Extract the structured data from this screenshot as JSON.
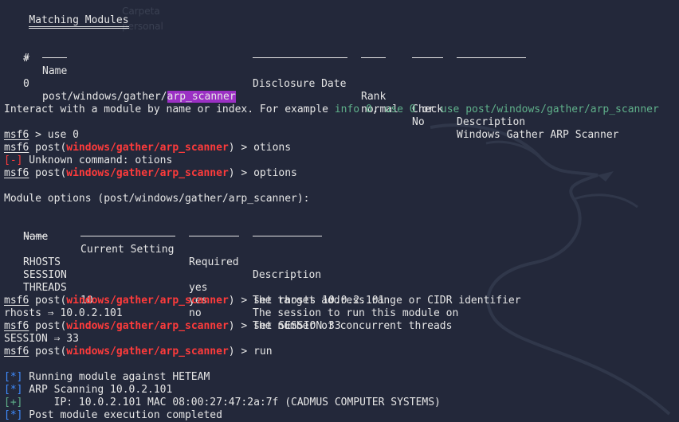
{
  "background": {
    "ghost_label_1": "Carpeta",
    "ghost_label_2": "personal",
    "color": "#23283a"
  },
  "matching": {
    "title": "Matching Modules",
    "headers": {
      "num": "#",
      "name": "Name",
      "date": "Disclosure Date",
      "rank": "Rank",
      "check": "Check",
      "desc": "Description"
    },
    "row": {
      "num": "0",
      "name_prefix": "post/windows/gather/",
      "name_hl": "arp_scanner",
      "date": "",
      "rank": "normal",
      "check": "No",
      "desc": "Windows Gather ARP Scanner"
    }
  },
  "interact": {
    "text1": "Interact with a module by name or index. For example ",
    "info": "info 0",
    "sep1": ", ",
    "use": "use 0",
    "sep2": " or ",
    "use_path": "use post/windows/gather/arp_scanner"
  },
  "prompt": {
    "name": "msf6",
    "post_open": "post(",
    "module": "windows/gather/arp_scanner",
    "post_close": ")",
    "arrow": " > "
  },
  "session": {
    "cmd1": "use 0",
    "cmd2": "otions",
    "err_tag": "[-]",
    "err_msg": " Unknown command: otions",
    "cmd3": "options",
    "module_options": "Module options (post/windows/gather/arp_scanner):"
  },
  "options": {
    "headers": {
      "name": "Name",
      "setting": "Current Setting",
      "required": "Required",
      "desc": "Description"
    },
    "rows": [
      {
        "name": "RHOSTS",
        "setting": "",
        "required": "yes",
        "desc": "The target address range or CIDR identifier"
      },
      {
        "name": "SESSION",
        "setting": "",
        "required": "yes",
        "desc": "The session to run this module on"
      },
      {
        "name": "THREADS",
        "setting": "10",
        "required": "no",
        "desc": "The number of concurrent threads"
      }
    ]
  },
  "run": {
    "cmd4": "set rhosts 10.0.2.101",
    "out4": "rhosts ⇒ 10.0.2.101",
    "cmd5": "set SESSION 33",
    "out5": "SESSION ⇒ 33",
    "cmd6": "run",
    "msgs": [
      {
        "tag": "[*]",
        "kind": "blue",
        "text": " Running module against HETEAM"
      },
      {
        "tag": "[*]",
        "kind": "blue",
        "text": " ARP Scanning 10.0.2.101"
      },
      {
        "tag": "[+]",
        "kind": "green",
        "text": "     IP: 10.0.2.101 MAC 08:00:27:47:2a:7f (CADMUS COMPUTER SYSTEMS)"
      },
      {
        "tag": "[*]",
        "kind": "blue",
        "text": " Post module execution completed"
      }
    ]
  },
  "colors": {
    "error": "#ff3b3b",
    "info": "#3f8cff",
    "success": "#5fb08a",
    "highlight": "#9b30c4",
    "text": "#e6e6e6"
  }
}
